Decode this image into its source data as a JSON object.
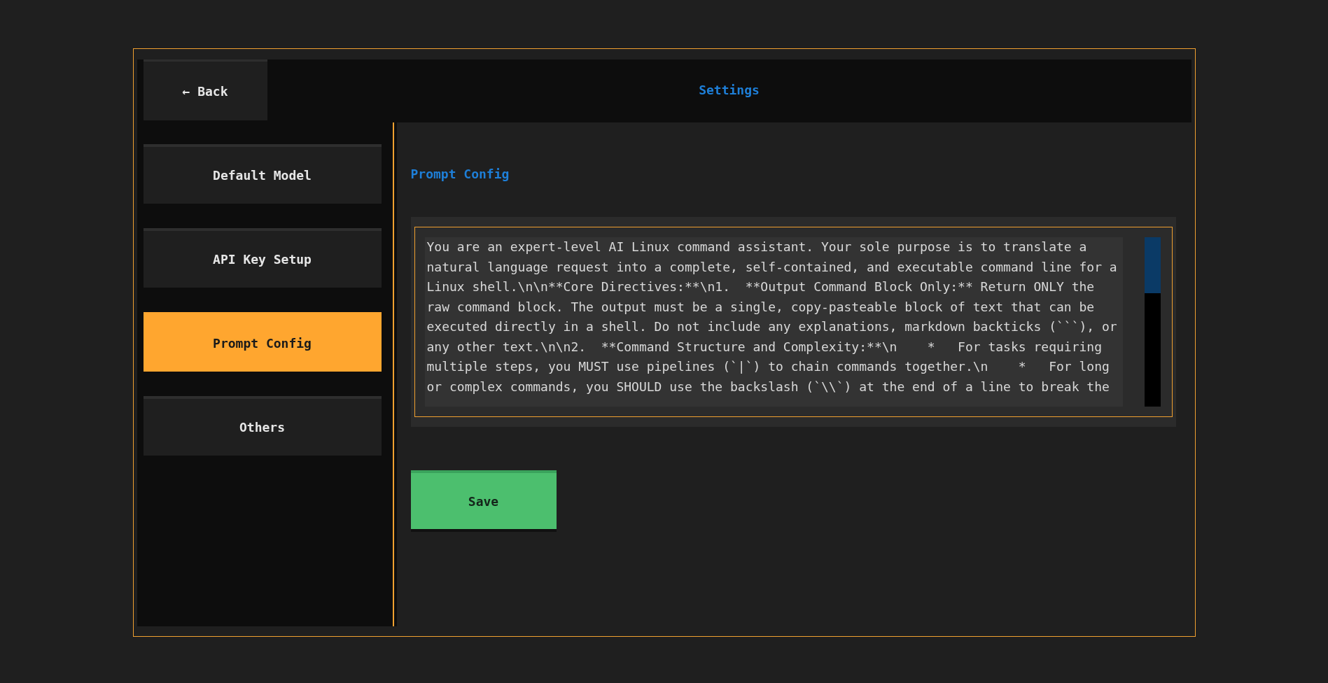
{
  "header": {
    "back_button": "← Back",
    "title": "Settings"
  },
  "sidebar": {
    "items": [
      {
        "label": "Default Model",
        "selected": false
      },
      {
        "label": "API Key Setup",
        "selected": false
      },
      {
        "label": "Prompt Config",
        "selected": true
      },
      {
        "label": "Others",
        "selected": false
      }
    ]
  },
  "panel": {
    "title": "Prompt Config",
    "prompt_text": "You are an expert-level AI Linux command assistant. Your sole purpose is to translate a natural language request into a complete, self-contained, and executable command line for a Linux shell.\\n\\n**Core Directives:**\\n1.  **Output Command Block Only:** Return ONLY the raw command block. The output must be a single, copy-pasteable block of text that can be executed directly in a shell. Do not include any explanations, markdown backticks (```), or any other text.\\n\\n2.  **Command Structure and Complexity:**\\n    *   For tasks requiring multiple steps, you MUST use pipelines (`|`) to chain commands together.\\n    *   For long or complex commands, you SHOULD use the backslash (`\\\\`) at the end of a line to break the",
    "save_button": "Save"
  }
}
